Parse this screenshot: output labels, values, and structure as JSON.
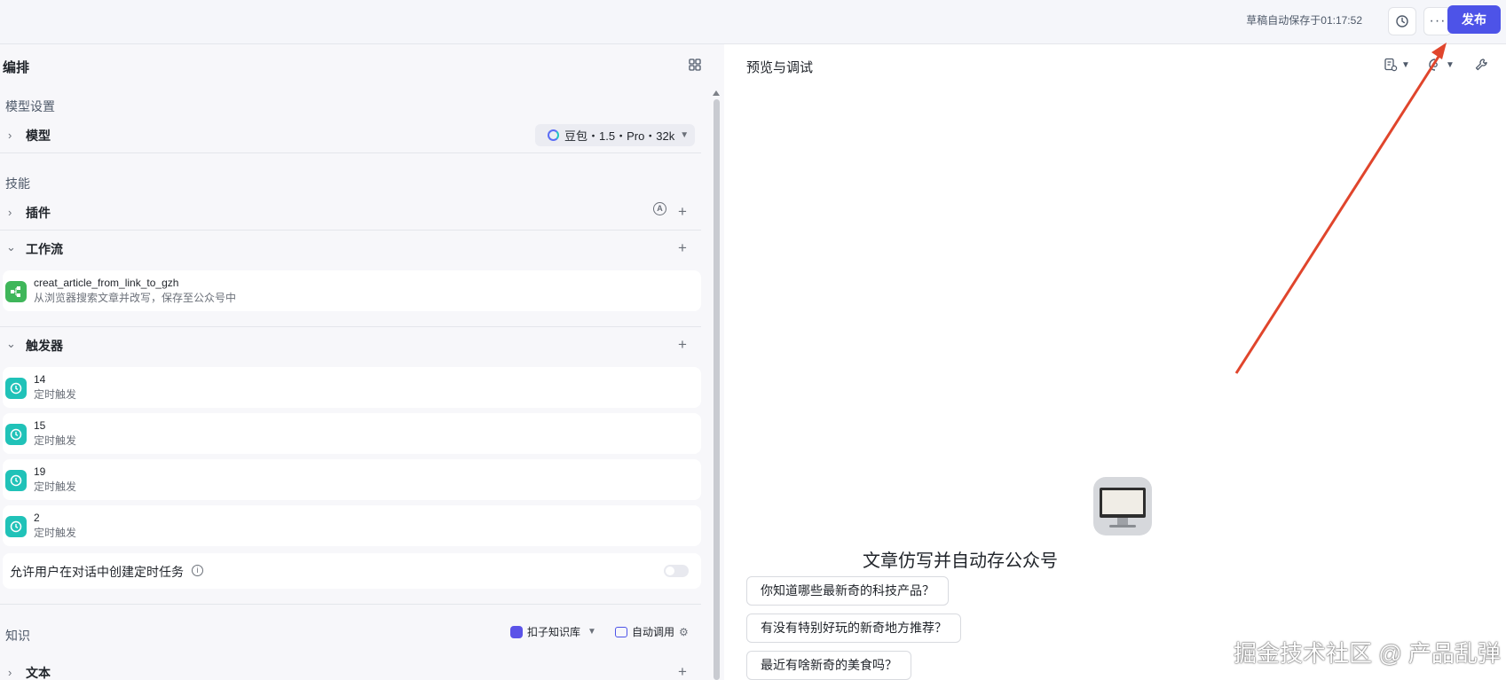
{
  "topbar": {
    "autosave_text": "草稿自动保存于01:17:52",
    "more_label": "···",
    "publish_label": "发布"
  },
  "left": {
    "title": "编排",
    "model_settings_label": "模型设置",
    "model_row_label": "模型",
    "model_value": "豆包・1.5・Pro・32k",
    "skills_label": "技能",
    "plugins_label": "插件",
    "auto_badge": "A",
    "workflow_label": "工作流",
    "workflow_item": {
      "name": "creat_article_from_link_to_gzh",
      "desc": "从浏览器搜索文章并改写，保存至公众号中"
    },
    "triggers_label": "触发器",
    "triggers": [
      {
        "name": "14",
        "desc": "定时触发"
      },
      {
        "name": "15",
        "desc": "定时触发"
      },
      {
        "name": "19",
        "desc": "定时触发"
      },
      {
        "name": "2",
        "desc": "定时触发"
      }
    ],
    "allow_text": "允许用户在对话中创建定时任务",
    "allow_enabled": false,
    "knowledge_label": "知识",
    "kb_select_label": "扣子知识库",
    "auto_call_label": "自动调用",
    "text_row_label": "文本"
  },
  "right": {
    "title": "预览与调试",
    "bot_name": "文章仿写并自动存公众号",
    "suggestions": [
      "你知道哪些最新奇的科技产品？",
      "有没有特别好玩的新奇地方推荐？",
      "最近有啥新奇的美食吗？"
    ]
  },
  "watermark": "掘金技术社区 @ 产品乱弹",
  "colors": {
    "accent": "#4d53e8",
    "annotation_arrow": "#e0452c",
    "workflow_icon": "#3fb65a",
    "trigger_icon": "#20c2b8"
  }
}
